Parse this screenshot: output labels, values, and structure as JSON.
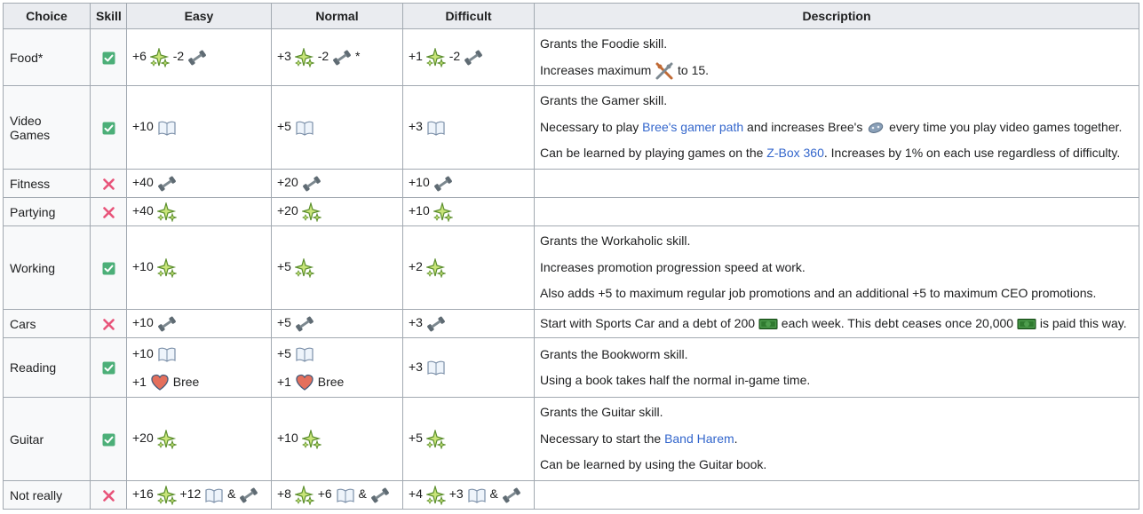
{
  "headers": {
    "choice": "Choice",
    "skill": "Skill",
    "easy": "Easy",
    "normal": "Normal",
    "difficult": "Difficult",
    "description": "Description"
  },
  "colors": {
    "header_bg": "#eaecf0",
    "border": "#a2a9b1",
    "link": "#3366cc",
    "check_green": "#4caf78",
    "cross_pink": "#e8547a"
  },
  "rows": [
    {
      "choice": "Food*",
      "skill": "check",
      "easy": [
        [
          {
            "t": "+6"
          },
          {
            "i": "sparkle"
          },
          {
            "t": "-2"
          },
          {
            "i": "dumbbell"
          }
        ]
      ],
      "normal": [
        [
          {
            "t": "+3"
          },
          {
            "i": "sparkle"
          },
          {
            "t": "-2"
          },
          {
            "i": "dumbbell"
          },
          {
            "t": "*"
          }
        ]
      ],
      "difficult": [
        [
          {
            "t": "+1"
          },
          {
            "i": "sparkle"
          },
          {
            "t": "-2"
          },
          {
            "i": "dumbbell"
          }
        ]
      ],
      "desc": [
        [
          {
            "t": "Grants the Foodie skill."
          }
        ],
        [
          {
            "t": "Increases maximum "
          },
          {
            "i": "utensils"
          },
          {
            "t": " to 15."
          }
        ]
      ]
    },
    {
      "choice": "Video Games",
      "skill": "check",
      "easy": [
        [
          {
            "t": "+10"
          },
          {
            "i": "book"
          }
        ]
      ],
      "normal": [
        [
          {
            "t": "+5"
          },
          {
            "i": "book"
          }
        ]
      ],
      "difficult": [
        [
          {
            "t": "+3"
          },
          {
            "i": "book"
          }
        ]
      ],
      "desc": [
        [
          {
            "t": "Grants the Gamer skill."
          }
        ],
        [
          {
            "t": "Necessary to play "
          },
          {
            "l": "Bree's gamer path"
          },
          {
            "t": " and increases Bree's "
          },
          {
            "i": "gamepad"
          },
          {
            "t": " every time you play video games together."
          }
        ],
        [
          {
            "t": "Can be learned by playing games on the "
          },
          {
            "l": "Z-Box 360"
          },
          {
            "t": ". Increases by 1% on each use regardless of difficulty."
          }
        ]
      ]
    },
    {
      "choice": "Fitness",
      "skill": "cross",
      "easy": [
        [
          {
            "t": "+40"
          },
          {
            "i": "dumbbell"
          }
        ]
      ],
      "normal": [
        [
          {
            "t": "+20"
          },
          {
            "i": "dumbbell"
          }
        ]
      ],
      "difficult": [
        [
          {
            "t": "+10"
          },
          {
            "i": "dumbbell"
          }
        ]
      ],
      "desc": []
    },
    {
      "choice": "Partying",
      "skill": "cross",
      "easy": [
        [
          {
            "t": "+40"
          },
          {
            "i": "sparkle"
          }
        ]
      ],
      "normal": [
        [
          {
            "t": "+20"
          },
          {
            "i": "sparkle"
          }
        ]
      ],
      "difficult": [
        [
          {
            "t": "+10"
          },
          {
            "i": "sparkle"
          }
        ]
      ],
      "desc": []
    },
    {
      "choice": "Working",
      "skill": "check",
      "easy": [
        [
          {
            "t": "+10"
          },
          {
            "i": "sparkle"
          }
        ]
      ],
      "normal": [
        [
          {
            "t": "+5"
          },
          {
            "i": "sparkle"
          }
        ]
      ],
      "difficult": [
        [
          {
            "t": "+2"
          },
          {
            "i": "sparkle"
          }
        ]
      ],
      "desc": [
        [
          {
            "t": "Grants the Workaholic skill."
          }
        ],
        [
          {
            "t": "Increases promotion progression speed at work."
          }
        ],
        [
          {
            "t": "Also adds +5 to maximum regular job promotions and an additional +5 to maximum CEO promotions."
          }
        ]
      ]
    },
    {
      "choice": "Cars",
      "skill": "cross",
      "easy": [
        [
          {
            "t": "+10"
          },
          {
            "i": "dumbbell"
          }
        ]
      ],
      "normal": [
        [
          {
            "t": "+5"
          },
          {
            "i": "dumbbell"
          }
        ]
      ],
      "difficult": [
        [
          {
            "t": "+3"
          },
          {
            "i": "dumbbell"
          }
        ]
      ],
      "desc": [
        [
          {
            "t": "Start with Sports Car and a debt of 200 "
          },
          {
            "i": "money"
          },
          {
            "t": " each week. This debt ceases once 20,000 "
          },
          {
            "i": "money"
          },
          {
            "t": " is paid this way."
          }
        ]
      ]
    },
    {
      "choice": "Reading",
      "skill": "check",
      "easy": [
        [
          {
            "t": "+10"
          },
          {
            "i": "book"
          }
        ],
        [
          {
            "t": "+1"
          },
          {
            "i": "heart"
          },
          {
            "t": "Bree"
          }
        ]
      ],
      "normal": [
        [
          {
            "t": "+5"
          },
          {
            "i": "book"
          }
        ],
        [
          {
            "t": "+1"
          },
          {
            "i": "heart"
          },
          {
            "t": "Bree"
          }
        ]
      ],
      "difficult": [
        [
          {
            "t": "+3"
          },
          {
            "i": "book"
          }
        ]
      ],
      "desc": [
        [
          {
            "t": "Grants the Bookworm skill."
          }
        ],
        [
          {
            "t": "Using a book takes half the normal in-game time."
          }
        ]
      ]
    },
    {
      "choice": "Guitar",
      "skill": "check",
      "easy": [
        [
          {
            "t": "+20"
          },
          {
            "i": "sparkle"
          }
        ]
      ],
      "normal": [
        [
          {
            "t": "+10"
          },
          {
            "i": "sparkle"
          }
        ]
      ],
      "difficult": [
        [
          {
            "t": "+5"
          },
          {
            "i": "sparkle"
          }
        ]
      ],
      "desc": [
        [
          {
            "t": "Grants the Guitar skill."
          }
        ],
        [
          {
            "t": "Necessary to start the "
          },
          {
            "l": "Band Harem"
          },
          {
            "t": "."
          }
        ],
        [
          {
            "t": "Can be learned by using the Guitar book."
          }
        ]
      ]
    },
    {
      "choice": "Not really",
      "skill": "cross",
      "easy": [
        [
          {
            "t": "+16"
          },
          {
            "i": "sparkle"
          },
          {
            "t": "+12"
          },
          {
            "i": "book"
          },
          {
            "t": "&"
          },
          {
            "i": "dumbbell"
          }
        ]
      ],
      "normal": [
        [
          {
            "t": "+8"
          },
          {
            "i": "sparkle"
          },
          {
            "t": "+6"
          },
          {
            "i": "book"
          },
          {
            "t": "&"
          },
          {
            "i": "dumbbell"
          }
        ]
      ],
      "difficult": [
        [
          {
            "t": "+4"
          },
          {
            "i": "sparkle"
          },
          {
            "t": "+3"
          },
          {
            "i": "book"
          },
          {
            "t": "&"
          },
          {
            "i": "dumbbell"
          }
        ]
      ],
      "desc": []
    }
  ]
}
